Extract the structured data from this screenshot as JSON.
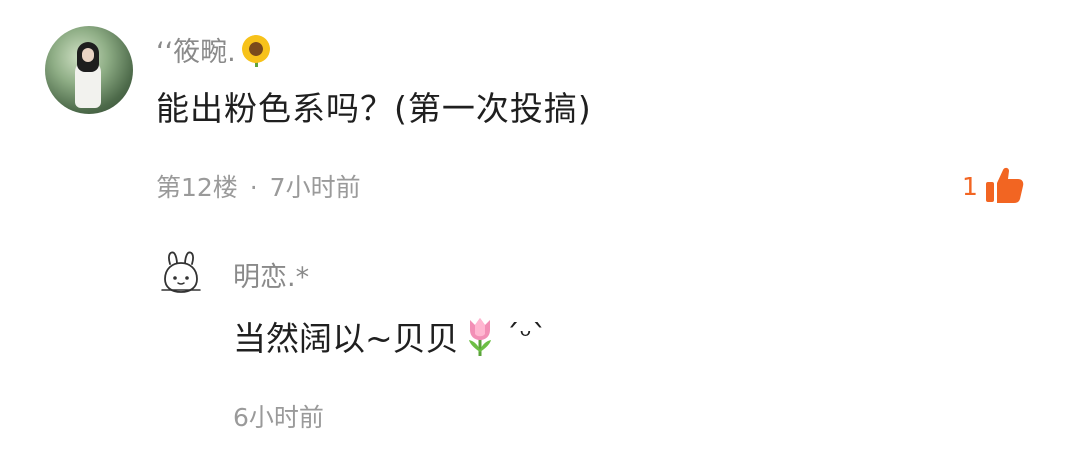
{
  "comment": {
    "username": "‘‘筱畹.",
    "username_emoji": "sunflower-icon",
    "text": "能出粉色系吗？(第一次投搞)",
    "floor": "第12楼",
    "separator": "·",
    "time": "7小时前",
    "like_count": "1",
    "like_color": "#f26522"
  },
  "reply": {
    "username": "明恋.*",
    "text": "当然阔以~贝贝",
    "text_emoji": "tulip-icon",
    "kaomoji": "ˊᵕˋ",
    "time": "6小时前"
  }
}
